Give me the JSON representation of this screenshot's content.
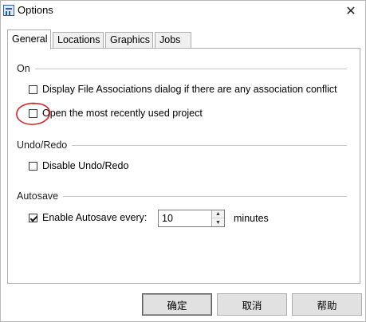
{
  "window": {
    "title": "Options"
  },
  "tabs": [
    {
      "label": "General",
      "active": true
    },
    {
      "label": "Locations",
      "active": false
    },
    {
      "label": "Graphics",
      "active": false
    },
    {
      "label": "Jobs",
      "active": false
    }
  ],
  "groups": {
    "on": {
      "label": "On",
      "options": [
        {
          "label": "Display File Associations dialog if there are any association conflict",
          "checked": false
        },
        {
          "label": "Open the most recently used project",
          "checked": false
        }
      ]
    },
    "undo_redo": {
      "label": "Undo/Redo",
      "options": [
        {
          "label": "Disable Undo/Redo",
          "checked": false
        }
      ]
    },
    "autosave": {
      "label": "Autosave",
      "enable_label": "Enable Autosave every:",
      "enabled": true,
      "interval_value": "10",
      "unit": "minutes"
    }
  },
  "buttons": {
    "ok": "确定",
    "cancel": "取消",
    "help": "帮助"
  },
  "annotation": {
    "color": "#d8262b"
  },
  "icons": {
    "app": "options-app-icon",
    "close": "close-icon"
  }
}
